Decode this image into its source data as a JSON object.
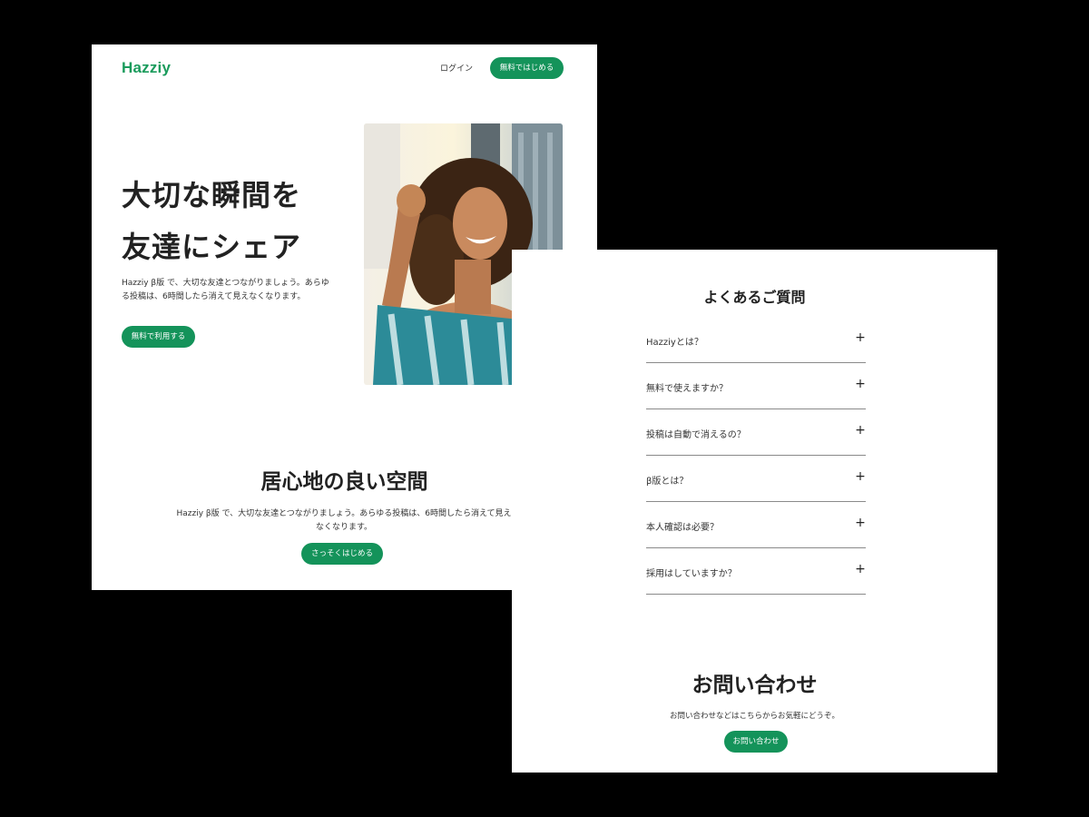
{
  "landing": {
    "logo": "Hazziy",
    "nav": {
      "login": "ログイン",
      "free_start": "無料ではじめる"
    },
    "hero": {
      "title_lines": [
        "大切な瞬間を",
        "友達にシェア"
      ],
      "description": "Hazziy β版 で、大切な友達とつながりましょう。あらゆる投稿は、6時間したら消えて見えなくなります。",
      "cta": "無料で利用する",
      "photo": "smiling-woman-photo"
    },
    "section2": {
      "title": "居心地の良い空間",
      "description": "Hazziy β版 で、大切な友達とつながりましょう。あらゆる投稿は、6時間したら消えて見えなくなります。",
      "cta": "さっそくはじめる"
    }
  },
  "faq": {
    "title": "よくあるご質問",
    "items": [
      {
        "question": "Hazziyとは？",
        "icon": "+"
      },
      {
        "question": "無料で使えますか？",
        "icon": "+"
      },
      {
        "question": "投稿は自動で消えるの？",
        "icon": "+"
      },
      {
        "question": "β版とは？",
        "icon": "+"
      },
      {
        "question": "本人確認は必要？",
        "icon": "+"
      },
      {
        "question": "採用はしていますか？",
        "icon": "+"
      }
    ]
  },
  "contact": {
    "title": "お問い合わせ",
    "description": "お問い合わせなどはこちらからお気軽にどうぞ。",
    "cta": "お問い合わせ"
  },
  "colors": {
    "brand_green": "#14935a",
    "background": "#000000",
    "card": "#ffffff"
  }
}
